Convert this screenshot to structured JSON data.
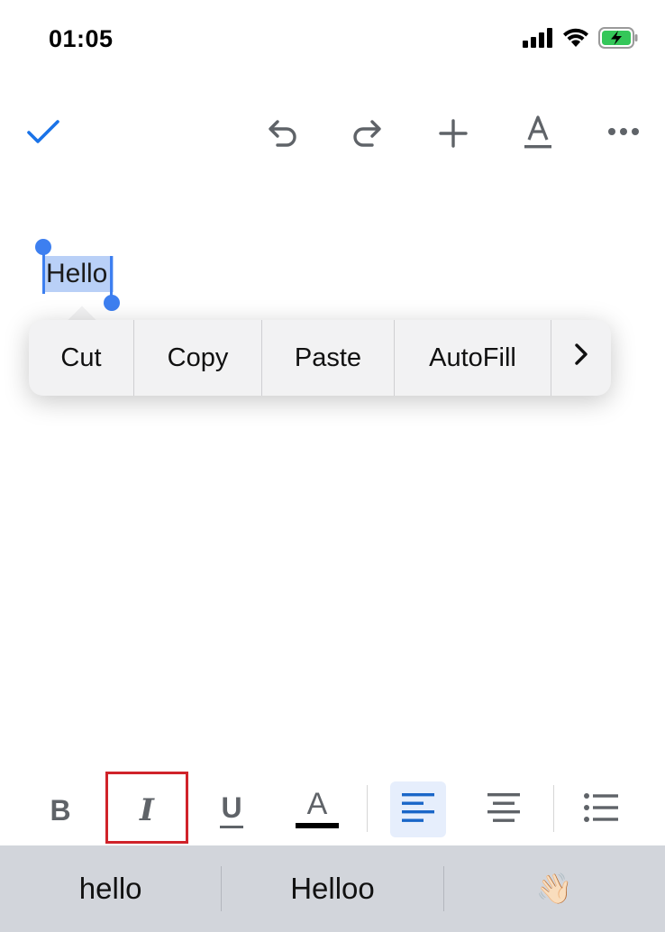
{
  "status_bar": {
    "time": "01:05",
    "icons": [
      "signal-icon",
      "wifi-icon",
      "battery-charging-icon"
    ],
    "battery_color": "#34c759"
  },
  "toolbar": {
    "icons": [
      "checkmark-icon",
      "undo-icon",
      "redo-icon",
      "insert-plus-icon",
      "text-format-icon",
      "more-options-icon"
    ],
    "accent_color": "#1a73e8"
  },
  "document": {
    "selected_text": "Hello",
    "selection_color": "#b9d0f7"
  },
  "context_menu": {
    "items": [
      "Cut",
      "Copy",
      "Paste",
      "AutoFill"
    ],
    "more_icon": "chevron-right-icon"
  },
  "format_bar": {
    "bold_label": "B",
    "italic_label": "I",
    "underline_label": "U",
    "text_color_label": "A",
    "text_color_swatch": "#000000",
    "active_alignment": "align-left",
    "icons": [
      "bold-icon",
      "italic-icon",
      "underline-icon",
      "text-color-icon",
      "align-left-icon",
      "align-center-icon",
      "bulleted-list-icon"
    ],
    "highlight_color": "#d0232a"
  },
  "keyboard_suggestions": [
    "hello",
    "Helloo",
    "👋🏻"
  ]
}
